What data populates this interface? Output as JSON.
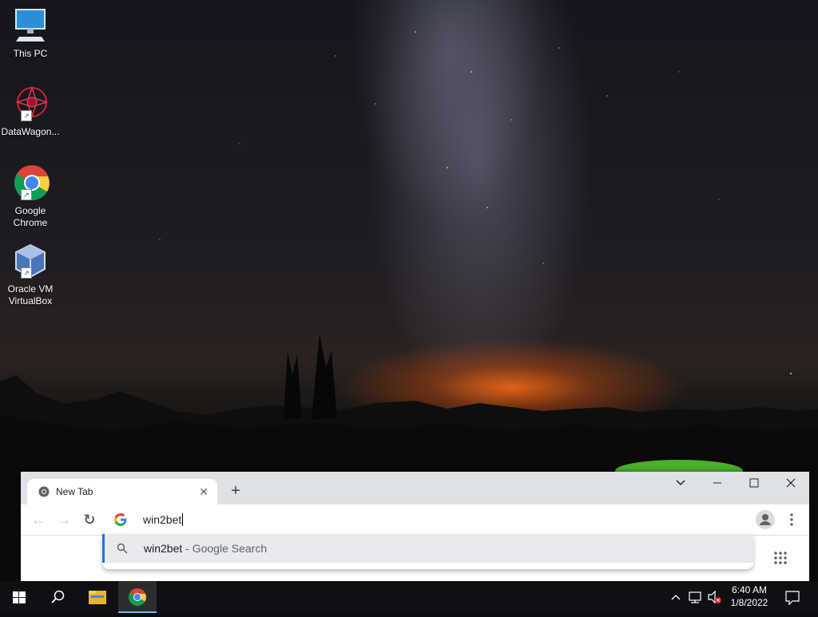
{
  "desktop": {
    "icons": [
      {
        "label": "This PC",
        "icon": "this-pc-icon"
      },
      {
        "label": "DataWagon...",
        "icon": "datawagon-icon"
      },
      {
        "label": "Google Chrome",
        "icon": "chrome-icon"
      },
      {
        "label": "Oracle VM VirtualBox",
        "icon": "virtualbox-icon"
      }
    ]
  },
  "browser": {
    "tab": {
      "title": "New Tab",
      "close_symbol": "✕"
    },
    "new_tab_symbol": "+",
    "window_controls": {
      "dropdown": "⌄",
      "minimize": "—",
      "maximize": "☐",
      "close": "✕"
    },
    "nav": {
      "back": "←",
      "forward": "→",
      "reload": "↻"
    },
    "omnibox": {
      "value": "win2bet"
    },
    "suggestion": {
      "query": "win2bet",
      "suffix": " - Google Search"
    }
  },
  "taskbar": {
    "time": "6:40 AM",
    "date": "1/8/2022",
    "items": [
      "start-button",
      "search-button",
      "file-explorer",
      "chrome"
    ]
  },
  "colors": {
    "accent": "#1a73e8",
    "tabstrip": "#dee1e6",
    "taskbar_active": "#76b9ed"
  }
}
